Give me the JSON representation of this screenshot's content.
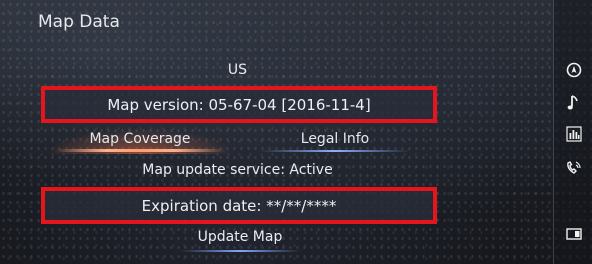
{
  "header": {
    "title": "Map Data"
  },
  "map_info": {
    "region": "US",
    "version_text": "Map version: 05-67-04  [2016-11-4]",
    "service_text": "Map update service: Active",
    "expiration_text": "Expiration date: **/**/****"
  },
  "tabs": [
    {
      "label": "Map Coverage",
      "active": true
    },
    {
      "label": "Legal Info",
      "active": false
    }
  ],
  "actions": {
    "update_label": "Update Map"
  },
  "sidebar": {
    "icons": [
      "navigation-icon",
      "music-note-icon",
      "equalizer-icon",
      "phone-voice-icon",
      "screen-toggle-icon"
    ]
  },
  "colors": {
    "highlight_frame": "#e5141d",
    "active_tab_glow": "#ff9c70",
    "tab_accent": "#8fb0ff"
  }
}
